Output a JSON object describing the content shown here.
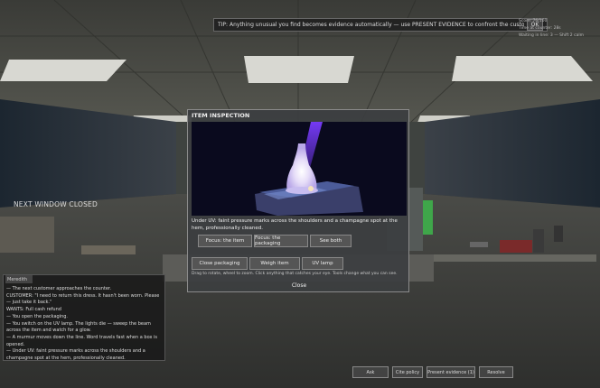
{
  "tip": {
    "text": "TIP: Anything unusual you find becomes evidence automatically — use PRESENT EVIDENCE to confront the customer with it.",
    "ok_label": "OK"
  },
  "hud": {
    "line1": "Score: 76/100",
    "line2": "Time at counter: 28s",
    "line3": "Waiting in line: 3 — Shift 2 calm"
  },
  "status": {
    "next_window": "NEXT WINDOW CLOSED"
  },
  "inspection": {
    "title": "ITEM INSPECTION",
    "description": "Under UV: faint pressure marks across the shoulders and a champagne spot at the hem, professionally cleaned.",
    "focus_buttons": [
      "Focus: the item",
      "Focus: the packaging",
      "See both"
    ],
    "tool_buttons": [
      "Close packaging",
      "Weigh item",
      "UV lamp"
    ],
    "hint": "Drag to rotate, wheel to zoom. Click anything that catches your eye. Tools change what you can see.",
    "close_label": "Close"
  },
  "log": {
    "title": "Meredith",
    "lines": [
      "— The next customer approaches the counter.",
      "CUSTOMER: \"I need to return this dress. It hasn't been worn. Please — just take it back.\"",
      "WANTS: Full cash refund",
      "— You open the packaging.",
      "— You switch on the UV lamp. The lights die — sweep the beam across the item and watch for a glow.",
      "— A murmur moves down the line. Word travels fast when a box is opened.",
      "— Under UV: faint pressure marks across the shoulders and a champagne spot at the hem, professionally cleaned."
    ]
  },
  "actions": [
    "Ask",
    "Cite policy",
    "Present evidence (1)",
    "Resolve"
  ],
  "colors": {
    "uv_purple": "#7a3cff",
    "panel_bg": "#3c3e40",
    "accent_green": "#3fa64a"
  }
}
